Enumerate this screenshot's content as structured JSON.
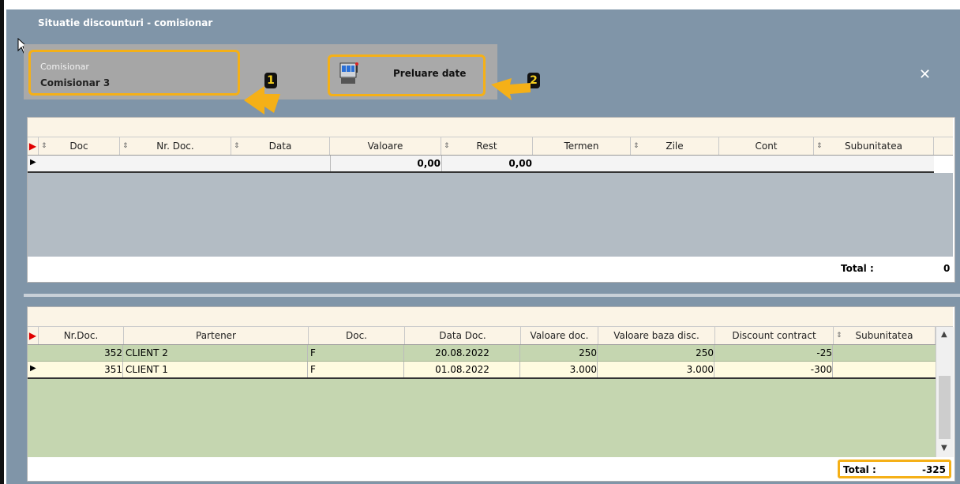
{
  "window": {
    "title": "Situatie discounturi - comisionar"
  },
  "comisionar": {
    "label": "Comisionar",
    "value": "Comisionar 3"
  },
  "actions": {
    "preluare_label": "Preluare date"
  },
  "annotations": {
    "badge1": "1",
    "badge2": "2"
  },
  "close_symbol": "✕",
  "top_grid": {
    "columns": [
      "Doc",
      "Nr. Doc.",
      "Data",
      "Valoare",
      "Rest",
      "Termen",
      "Zile",
      "Cont",
      "Subunitatea"
    ],
    "row": {
      "valoare": "0,00",
      "rest": "0,00"
    },
    "total_label": "Total :",
    "total_value": "0"
  },
  "bottom_grid": {
    "columns": [
      "Nr.Doc.",
      "Partener",
      "Doc.",
      "Data Doc.",
      "Valoare doc.",
      "Valoare baza disc.",
      "Discount contract",
      "Subunitatea"
    ],
    "rows": [
      {
        "nr": "352",
        "partener": "CLIENT 2",
        "doc": "F",
        "data": "20.08.2022",
        "valoare": "250",
        "baza": "250",
        "discount": "-25",
        "subunitatea": ""
      },
      {
        "nr": "351",
        "partener": "CLIENT 1",
        "doc": "F",
        "data": "01.08.2022",
        "valoare": "3.000",
        "baza": "3.000",
        "discount": "-300",
        "subunitatea": ""
      }
    ],
    "total_label": "Total :",
    "total_value": "-325"
  },
  "colors": {
    "accent": "#f5b017",
    "window_bg": "#8095a8",
    "row_green": "#c5d6b0",
    "row_selected": "#fffbe0"
  },
  "icons": [
    "cursor-arrow-icon",
    "slot-machine-icon",
    "close-icon",
    "row-marker-icon",
    "sort-icon",
    "scroll-up-icon",
    "scroll-down-icon"
  ]
}
